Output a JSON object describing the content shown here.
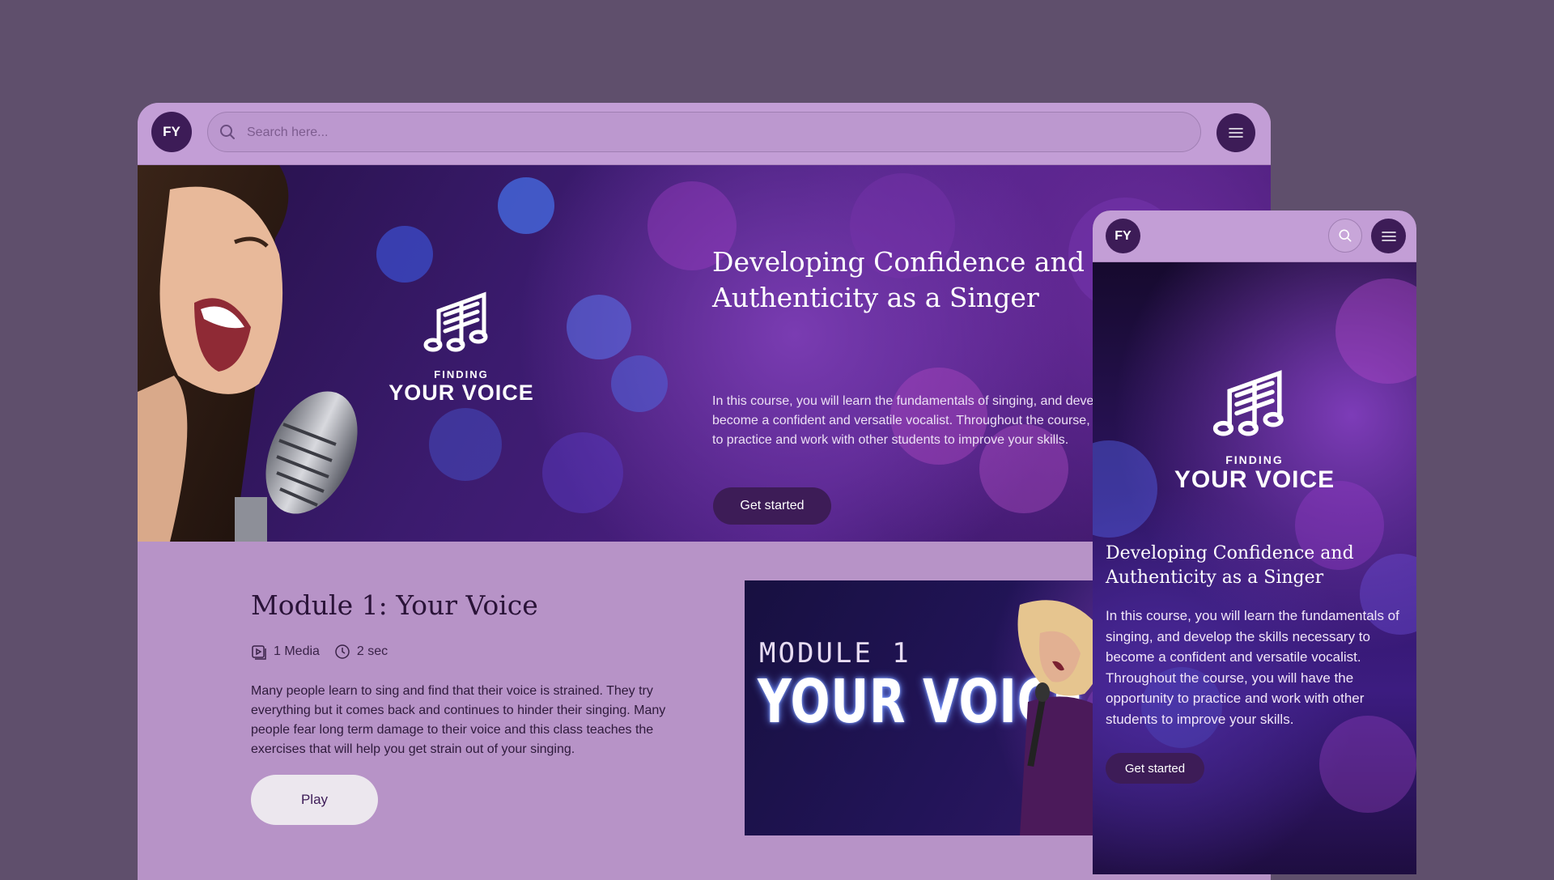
{
  "brand": {
    "initials": "FY",
    "logo_top": "FINDING",
    "logo_bottom": "YOUR VOICE"
  },
  "search": {
    "placeholder": "Search here..."
  },
  "hero": {
    "title": "Developing Confidence and Authenticity as a Singer",
    "description": "In this course, you will learn the fundamentals of singing, and develop the skills necessary to become a confident and versatile vocalist. Throughout the course, you will have the opportunity to practice and work with other students to improve your skills.",
    "cta_label": "Get started"
  },
  "module": {
    "title": "Module 1: Your Voice",
    "media_count": "1 Media",
    "duration": "2 sec",
    "description": "Many people learn to sing and find that their voice is strained. They try everything but it comes back and continues to hinder their singing. Many people fear long term damage to their voice and this class teaches the exercises that will help you get strain out of your singing.",
    "play_label": "Play",
    "thumbnail_line1": "MODULE 1",
    "thumbnail_line2": "YOUR VOICE"
  },
  "icons": {
    "search": "search-icon",
    "menu": "hamburger-menu-icon",
    "media": "media-icon",
    "clock": "clock-icon",
    "logo": "music-notes-logo"
  },
  "colors": {
    "page_background": "#5f4f6c",
    "header_background": "#c39ed6",
    "content_background": "#b793c7",
    "accent_dark": "#3d1c57",
    "play_button": "#ece7ee"
  }
}
